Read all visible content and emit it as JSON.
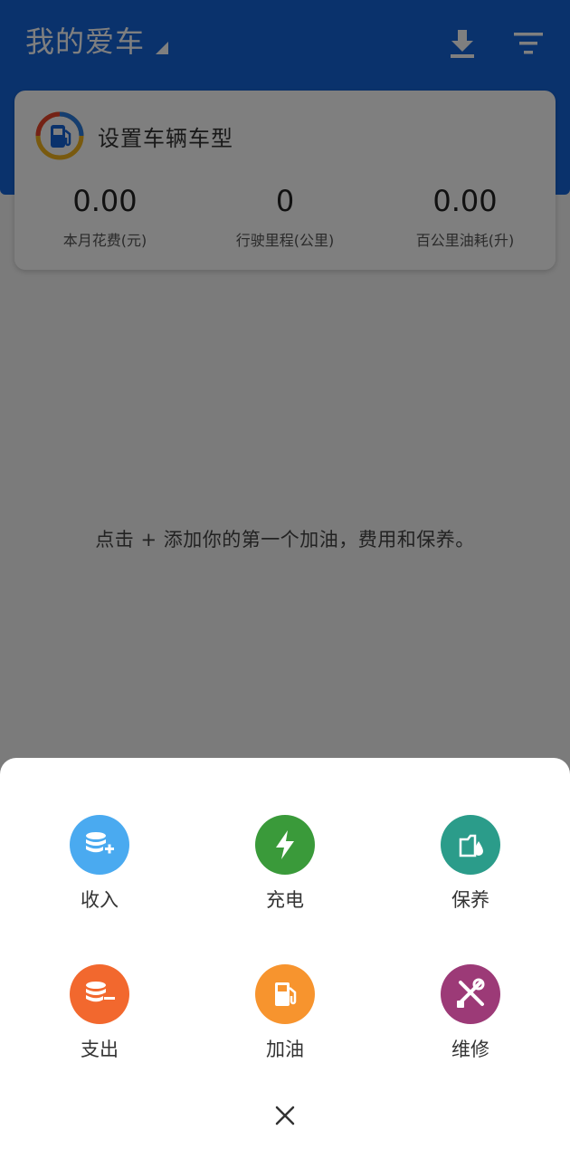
{
  "app_bar": {
    "title": "我的爱车",
    "icons": [
      "caret-down-icon",
      "download-icon",
      "filter-icon"
    ],
    "color": "#1565d8"
  },
  "vehicle_card": {
    "logo_icon": "fuel-pump-ring-icon",
    "setup_text": "设置车辆车型",
    "stats": [
      {
        "value": "0.00",
        "label": "本月花费(元)"
      },
      {
        "value": "0",
        "label": "行驶里程(公里)"
      },
      {
        "value": "0.00",
        "label": "百公里油耗(升)"
      }
    ]
  },
  "empty_state": {
    "text": "点击 + 添加你的第一个加油，费用和保养。"
  },
  "action_sheet": {
    "actions": [
      {
        "label": "收入",
        "icon": "income-coins-icon",
        "color": "#4aaaf0"
      },
      {
        "label": "充电",
        "icon": "charge-bolt-icon",
        "color": "#3a9a3a"
      },
      {
        "label": "保养",
        "icon": "maintenance-oil-icon",
        "color": "#2b9c8a"
      },
      {
        "label": "支出",
        "icon": "expense-coins-icon",
        "color": "#f2682e"
      },
      {
        "label": "加油",
        "icon": "refuel-pump-icon",
        "color": "#f7942e"
      },
      {
        "label": "维修",
        "icon": "repair-tools-icon",
        "color": "#9c3a77"
      }
    ],
    "close_icon": "close-icon"
  }
}
